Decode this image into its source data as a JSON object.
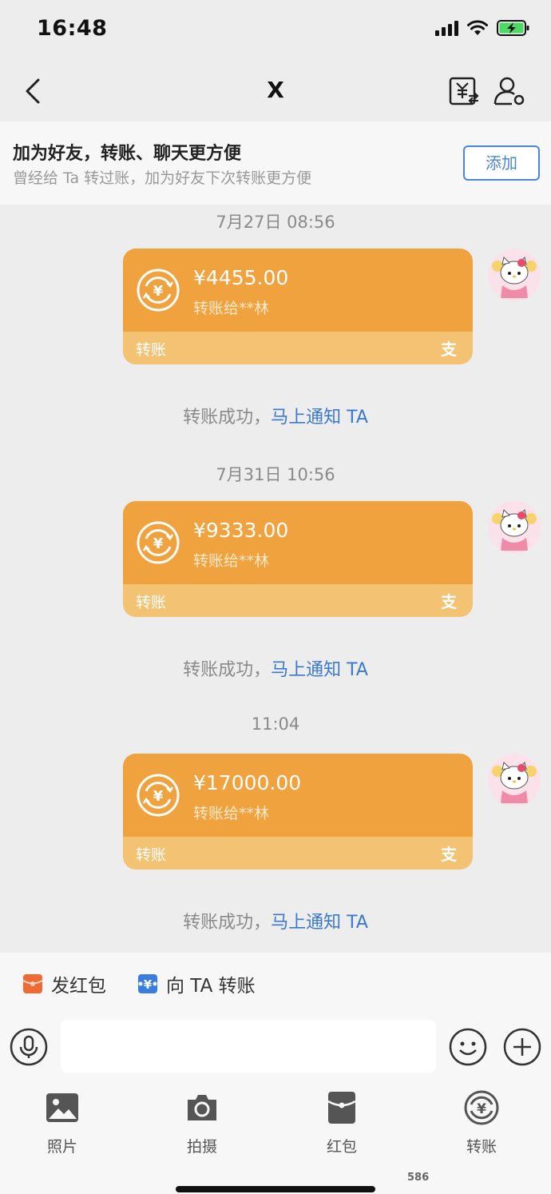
{
  "status_bar": {
    "time": "16:48"
  },
  "nav": {
    "title": "X"
  },
  "add_friend": {
    "title": "加为好友，转账、聊天更方便",
    "subtitle": "曾经给 Ta 转过账，加为好友下次转账更方便",
    "button_label": "添加"
  },
  "messages": [
    {
      "time": "7月27日 08:56",
      "amount": "¥4455.00",
      "desc": "转账给**林",
      "type_label": "转账",
      "logo": "支",
      "status": "转账成功，",
      "status_link": "马上通知 TA"
    },
    {
      "time": "7月31日 10:56",
      "amount": "¥9333.00",
      "desc": "转账给**林",
      "type_label": "转账",
      "logo": "支",
      "status": "转账成功，",
      "status_link": "马上通知 TA"
    },
    {
      "time": "11:04",
      "amount": "¥17000.00",
      "desc": "转账给**林",
      "type_label": "转账",
      "logo": "支",
      "status": "转账成功，",
      "status_link": "马上通知 TA"
    }
  ],
  "quick_actions": [
    {
      "label": "发红包",
      "icon": "red-packet-icon"
    },
    {
      "label": "向 TA 转账",
      "icon": "transfer-icon"
    }
  ],
  "input": {
    "placeholder": ""
  },
  "toolbar": [
    {
      "label": "照片",
      "icon": "photo-icon"
    },
    {
      "label": "拍摄",
      "icon": "camera-icon"
    },
    {
      "label": "红包",
      "icon": "red-packet-icon"
    },
    {
      "label": "转账",
      "icon": "transfer-icon"
    }
  ],
  "watermark": "586",
  "colors": {
    "card_orange": "#f0a23f",
    "card_footer": "#f4c273",
    "link_blue": "#3b78cf",
    "background": "#ededed"
  }
}
